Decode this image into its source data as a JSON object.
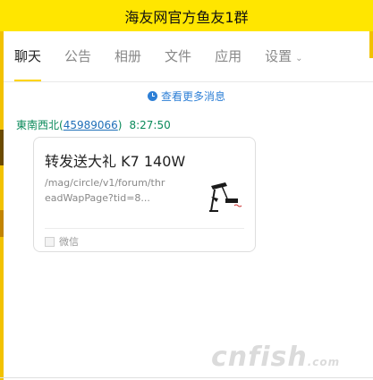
{
  "window": {
    "title": "海友网官方鱼友1群"
  },
  "tabs": [
    {
      "label": "聊天",
      "active": true
    },
    {
      "label": "公告"
    },
    {
      "label": "相册"
    },
    {
      "label": "文件"
    },
    {
      "label": "应用"
    },
    {
      "label": "设置",
      "chevron": "chevron-down-icon"
    }
  ],
  "chat": {
    "more_messages": "查看更多消息",
    "message": {
      "sender_name": "東南西北",
      "sender_qq_open": "(",
      "sender_qq": "45989066",
      "sender_qq_close": ")",
      "time": "8:27:50",
      "card": {
        "title": "转发送大礼 K7 140W",
        "description": "/mag/circle/v1/forum/threadWapPage?tid=8...",
        "source": "微信",
        "thumbnail_icon": "lamp-product-image"
      }
    }
  },
  "watermark": {
    "main": "cnfish",
    "suffix": ".com"
  },
  "colors": {
    "title_bar": "#ffe600",
    "tab_underline": "#ffd400",
    "link_blue": "#2d7fd6",
    "sender_green": "#0a8a5a"
  }
}
